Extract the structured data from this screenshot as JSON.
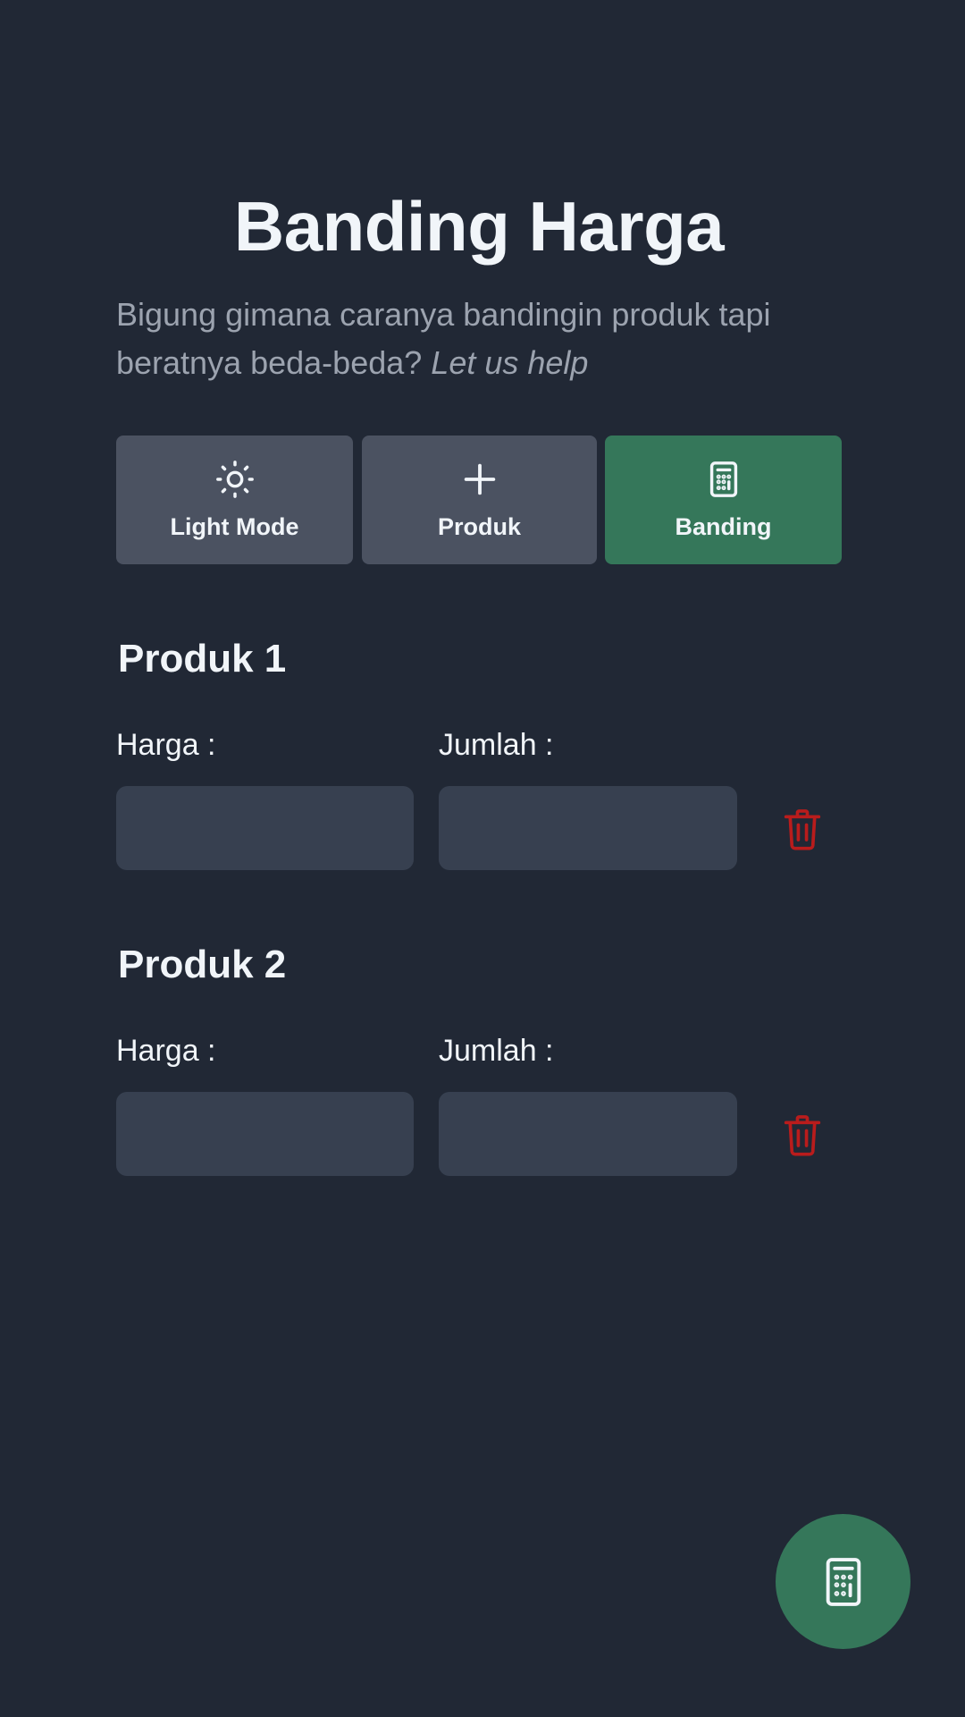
{
  "header": {
    "title": "Banding Harga",
    "subtitle_main": "Bigung gimana caranya bandingin produk tapi beratnya beda-beda? ",
    "subtitle_emphasis": "Let us help"
  },
  "actions": {
    "light_mode": {
      "label": "Light Mode",
      "icon": "sun-icon"
    },
    "add_product": {
      "label": "Produk",
      "icon": "plus-icon"
    },
    "compare": {
      "label": "Banding",
      "icon": "calculator-icon",
      "color": "#35775a"
    }
  },
  "products": [
    {
      "title": "Produk 1",
      "price_label": "Harga :",
      "price_value": "",
      "qty_label": "Jumlah :",
      "qty_value": "",
      "delete_icon": "trash-icon"
    },
    {
      "title": "Produk 2",
      "price_label": "Harga :",
      "price_value": "",
      "qty_label": "Jumlah :",
      "qty_value": "",
      "delete_icon": "trash-icon"
    }
  ],
  "fab": {
    "icon": "calculator-icon",
    "color": "#35775a"
  },
  "colors": {
    "background": "#212835",
    "button": "#4b5261",
    "accent_green": "#35775a",
    "input": "#374050",
    "delete_red": "#b91c1c"
  }
}
